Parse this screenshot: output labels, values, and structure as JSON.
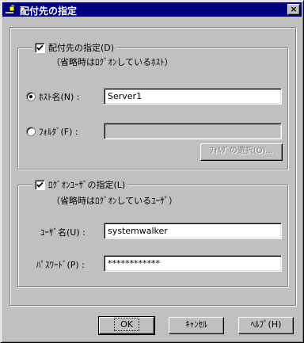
{
  "window": {
    "title": "配付先の指定",
    "close_glyph": "×"
  },
  "dest_group": {
    "checkbox_label": "配付先の指定(D)",
    "checked": true,
    "note": "（省略時はﾛｸﾞｵﾝしているﾎｽﾄ）",
    "host_radio_label": "ﾎｽﾄ名(N) :",
    "host_value": "Server1",
    "folder_radio_label": "ﾌｫﾙﾀﾞ(F) :",
    "folder_value": "",
    "folder_select_button": "ﾌｫﾙﾀﾞの選択(O)..."
  },
  "logon_group": {
    "checkbox_label": "ﾛｸﾞｵﾝﾕｰｻﾞの指定(L)",
    "checked": true,
    "note": "（省略時はﾛｸﾞｵﾝしているﾕｰｻﾞ）",
    "user_label": "ﾕｰｻﾞ名(U) :",
    "user_value": "systemwalker",
    "password_label": "ﾊﾟｽﾜｰﾄﾞ(P) :",
    "password_value": "************"
  },
  "buttons": {
    "ok": "OK",
    "cancel": "ｷｬﾝｾﾙ",
    "help": "ﾍﾙﾌﾟ(H)"
  }
}
